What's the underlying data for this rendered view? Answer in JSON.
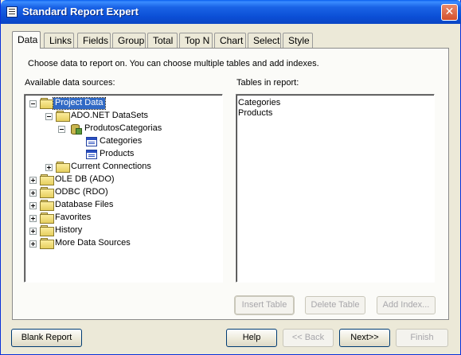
{
  "window": {
    "title": "Standard Report Expert",
    "close_glyph": "✕"
  },
  "tabs": [
    {
      "label": "Data",
      "active": true
    },
    {
      "label": "Links"
    },
    {
      "label": "Fields"
    },
    {
      "label": "Group"
    },
    {
      "label": "Total"
    },
    {
      "label": "Top N"
    },
    {
      "label": "Chart"
    },
    {
      "label": "Select"
    },
    {
      "label": "Style"
    }
  ],
  "instructions": "Choose data to report on. You can choose multiple tables and add indexes.",
  "available": {
    "label": "Available data sources:",
    "tree": [
      {
        "label": "Project Data",
        "selected": true
      },
      {
        "label": "ADO.NET DataSets"
      },
      {
        "label": "ProdutosCategorias"
      },
      {
        "label": "Categories"
      },
      {
        "label": "Products"
      },
      {
        "label": "Current Connections"
      },
      {
        "label": "OLE DB (ADO)"
      },
      {
        "label": "ODBC (RDO)"
      },
      {
        "label": "Database Files"
      },
      {
        "label": "Favorites"
      },
      {
        "label": "History"
      },
      {
        "label": "More Data Sources"
      }
    ]
  },
  "report_tables": {
    "label": "Tables in report:",
    "items": [
      "Categories",
      "Products"
    ]
  },
  "panel_buttons": {
    "insert_table": "Insert Table",
    "delete_table": "Delete Table",
    "add_index": "Add Index..."
  },
  "footer_buttons": {
    "blank_report": "Blank Report",
    "help": "Help",
    "back": "<< Back",
    "next": "Next>>",
    "finish": "Finish"
  }
}
